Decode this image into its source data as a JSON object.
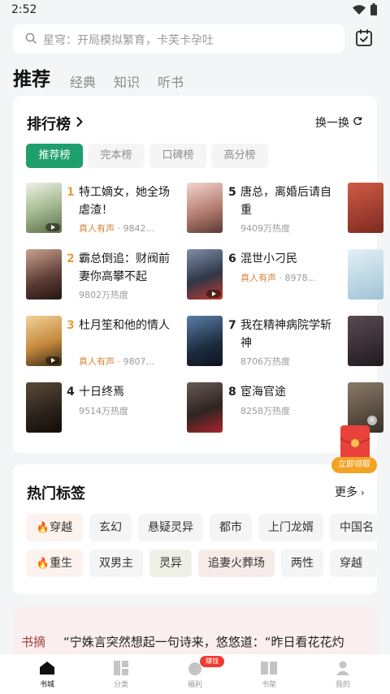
{
  "status": {
    "time": "2:52"
  },
  "search": {
    "placeholder": "星穹：开局模拟繁育，卡芙卡孕吐"
  },
  "top_tabs": [
    "推荐",
    "经典",
    "知识",
    "听书"
  ],
  "ranking": {
    "title": "排行榜",
    "refresh": "换一换",
    "chips": [
      "推荐榜",
      "完本榜",
      "口碑榜",
      "高分榜"
    ],
    "books": [
      {
        "rank": "1",
        "title": "特工嫡女，她全场虐渣！",
        "voice": "真人有声",
        "meta": " · 9842..."
      },
      {
        "rank": "2",
        "title": "霸总倒追：财阀前妻你高攀不起",
        "voice": "",
        "meta": "9802万热度"
      },
      {
        "rank": "3",
        "title": "杜月笙和他的情人",
        "voice": "真人有声",
        "meta": " · 9807..."
      },
      {
        "rank": "4",
        "title": "十日终焉",
        "voice": "",
        "meta": "9514万热度"
      },
      {
        "rank": "5",
        "title": "唐总，离婚后请自重",
        "voice": "",
        "meta": "9409万热度"
      },
      {
        "rank": "6",
        "title": "混世小刁民",
        "voice": "真人有声",
        "meta": " · 8978..."
      },
      {
        "rank": "7",
        "title": "我在精神病院学斩神",
        "voice": "",
        "meta": "8706万热度"
      },
      {
        "rank": "8",
        "title": "宦海官途",
        "voice": "",
        "meta": "8258万热度"
      }
    ]
  },
  "hot_tags": {
    "title": "热门标签",
    "more": "更多",
    "row1": [
      "穿越",
      "玄幻",
      "悬疑灵异",
      "都市",
      "上门龙婿",
      "中国名"
    ],
    "row2": [
      "重生",
      "双男主",
      "灵异",
      "追妻火葬场",
      "两性",
      "穿越"
    ]
  },
  "excerpt": {
    "label": "书摘",
    "text": "“宁姝言突然想起一句诗来，悠悠道：“昨日看花花灼"
  },
  "redpacket": {
    "label": "立即领取"
  },
  "bottom_nav": [
    {
      "label": "书城",
      "active": true
    },
    {
      "label": "分类",
      "active": false
    },
    {
      "label": "福利",
      "active": false,
      "badge": "赚钱"
    },
    {
      "label": "书架",
      "active": false
    },
    {
      "label": "我的",
      "active": false
    }
  ],
  "colors": {
    "accent": "#1f9f6c",
    "rank": "#e0a23a",
    "voice": "#d9843a"
  }
}
